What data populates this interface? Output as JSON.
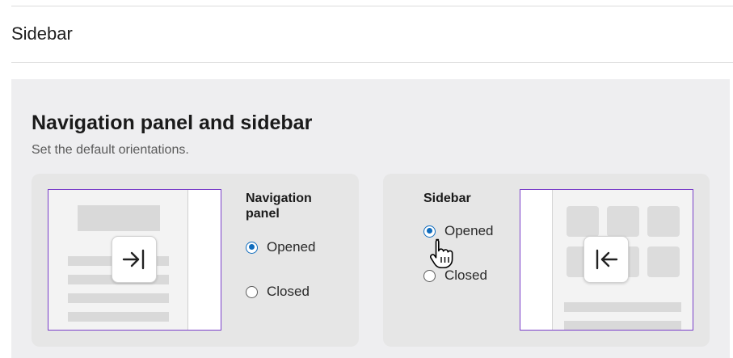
{
  "section": {
    "title": "Sidebar"
  },
  "panel": {
    "heading": "Navigation panel and sidebar",
    "description": "Set the default orientations."
  },
  "navigation_panel": {
    "label_line1": "Navigation",
    "label_line2": "panel",
    "options": [
      {
        "label": "Opened",
        "selected": true
      },
      {
        "label": "Closed",
        "selected": false
      }
    ],
    "toggle_icon": "collapse-to-right-icon"
  },
  "sidebar": {
    "label": "Sidebar",
    "options": [
      {
        "label": "Opened",
        "selected": true
      },
      {
        "label": "Closed",
        "selected": false
      }
    ],
    "toggle_icon": "expand-to-left-icon"
  },
  "colors": {
    "accent": "#0f6cbd",
    "preview_border": "#7a3fc9",
    "panel_background": "#eeeef0"
  }
}
